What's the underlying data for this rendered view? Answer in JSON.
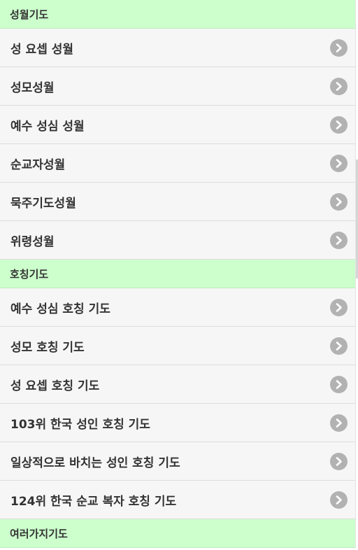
{
  "sections": [
    {
      "title": "성월기도",
      "items": [
        "성 요셉 성월",
        "성모성월",
        "예수 성심 성월",
        "순교자성월",
        "묵주기도성월",
        "위령성월"
      ]
    },
    {
      "title": "호칭기도",
      "items": [
        "예수 성심 호칭 기도",
        "성모 호칭 기도",
        "성 요셉 호칭 기도",
        "103위 한국 성인 호칭 기도",
        "일상적으로 바치는 성인 호칭 기도",
        "124위 한국 순교 복자 호칭 기도"
      ]
    },
    {
      "title": "여러가지기도",
      "items": []
    }
  ],
  "icons": {
    "item_arrow": "chevron-right-icon"
  },
  "colors": {
    "section_header_bg": "#ccffcc",
    "item_bg": "#f6f6f6",
    "arrow_bg": "#b2b2b2"
  }
}
